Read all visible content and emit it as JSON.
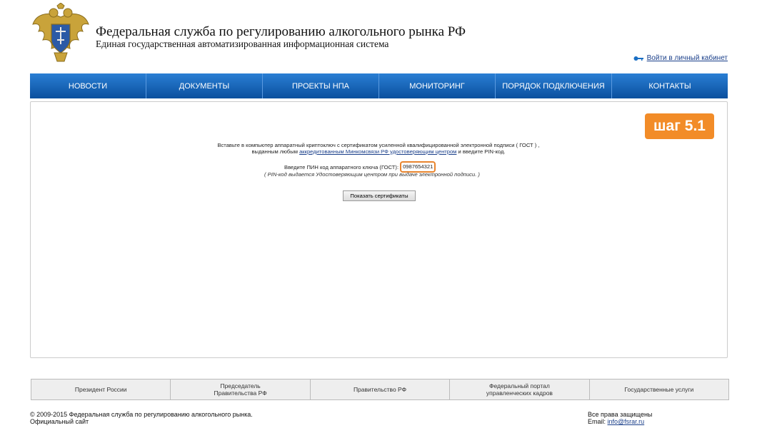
{
  "header": {
    "title": "Федеральная служба по регулированию алкогольного рынка РФ",
    "subtitle": "Единая государственная автоматизированная информационная система",
    "cabinet_link": "Войти в личный кабинет"
  },
  "nav": [
    "НОВОСТИ",
    "ДОКУМЕНТЫ",
    "ПРОЕКТЫ НПА",
    "МОНИТОРИНГ",
    "ПОРЯДОК ПОДКЛЮЧЕНИЯ",
    "КОНТАКТЫ"
  ],
  "step_badge": "шаг 5.1",
  "instructions": {
    "line1": "Вставьте в компьютер аппаратный криптоключ с сертификатом усиленной квалифицированной электронной подписи ( ГОСТ ) ,",
    "line2_pre": "выданным любым ",
    "line2_link": "аккредитованным Минкомсвязи РФ удостоверяющим центром",
    "line2_post": " и введите PIN-код."
  },
  "pin": {
    "label": "Введите ПИН код аппаратного ключа (ГОСТ):",
    "value": "0987654321",
    "note": "( PIN-код выдается Удостоверяющим центром при выдаче электронной подписи. )"
  },
  "show_button": "Показать сертификаты",
  "footer_links": [
    {
      "line1": "Президент России",
      "line2": ""
    },
    {
      "line1": "Председатель",
      "line2": "Правительства РФ"
    },
    {
      "line1": "Правительство РФ",
      "line2": ""
    },
    {
      "line1": "Федеральный портал",
      "line2": "управленческих кадров"
    },
    {
      "line1": "Государственные услуги",
      "line2": ""
    }
  ],
  "copyright": {
    "line1": "© 2009-2015 Федеральная служба по регулированию алкогольного рынка.",
    "line2": "Официальный сайт"
  },
  "rights": {
    "line1": "Все права защищены",
    "email_label": "Email: ",
    "email": "info@fsrar.ru"
  },
  "colors": {
    "nav": "#0a4f9e",
    "accent": "#f28c28",
    "link": "#1a3f8a"
  }
}
